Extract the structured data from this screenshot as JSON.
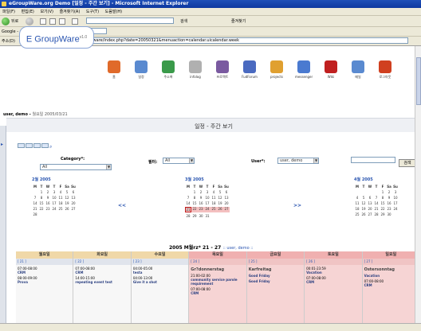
{
  "window": {
    "title": "eGroupWare.org Demo [일정 - 주간 보기] - Microsoft Internet Explorer"
  },
  "menu": [
    "파일(F)",
    "편집(E)",
    "보기(V)",
    "즐겨찾기(A)",
    "도구(T)",
    "도움말(H)"
  ],
  "toolbar": {
    "back": "뒤로",
    "search_label": "검색",
    "favorites_label": "즐겨찾기"
  },
  "linksbar": {
    "google_label": "Google -"
  },
  "address": {
    "label": "주소(D)",
    "url": "http://www.egroupware.org/egroupware/index.php?date=20050321&menuaction=calendar.uicalendar.week"
  },
  "logo": {
    "text": "E GroupWare",
    "version": "v1.0"
  },
  "apps": [
    {
      "label": "홈",
      "color": "#e06a2a"
    },
    {
      "label": "일정",
      "color": "#5a8ad0"
    },
    {
      "label": "주소록",
      "color": "#3a9a4a"
    },
    {
      "label": "infolog",
      "color": "#b0b0b0"
    },
    {
      "label": "프로젝트",
      "color": "#7a5aa0"
    },
    {
      "label": "FudForum",
      "color": "#4a6ac0"
    },
    {
      "label": "projects",
      "color": "#e0a030"
    },
    {
      "label": "messenger",
      "color": "#4a7ad0"
    },
    {
      "label": "Wiki",
      "color": "#c02020"
    },
    {
      "label": "메일",
      "color": "#5a8ad0"
    },
    {
      "label": "로그아웃",
      "color": "#d04020"
    }
  ],
  "user_line": {
    "user": "user, demo -",
    "date": "월요일 2005/03/21"
  },
  "page_title": "일정 - 주간 보기",
  "filters": {
    "category_label": "Category*:",
    "category_value": "All",
    "filter_label": "필터:",
    "filter_value": "All",
    "user_label": "User*:",
    "user_value": "user, demo",
    "go_label": "검색"
  },
  "calendars": [
    {
      "month": "2월 2005",
      "weekdays": [
        "M",
        "T",
        "W",
        "T",
        "F",
        "Sa",
        "Su"
      ],
      "rows": [
        [
          "",
          "1",
          "2",
          "3",
          "4",
          "5",
          "6"
        ],
        [
          "7",
          "8",
          "9",
          "10",
          "11",
          "12",
          "13"
        ],
        [
          "14",
          "15",
          "16",
          "17",
          "18",
          "19",
          "20"
        ],
        [
          "21",
          "22",
          "23",
          "24",
          "25",
          "26",
          "27"
        ],
        [
          "28",
          "",
          "",
          "",
          "",
          "",
          ""
        ]
      ]
    },
    {
      "month": "3월 2005",
      "weekdays": [
        "M",
        "T",
        "W",
        "T",
        "F",
        "Sa",
        "Su"
      ],
      "rows": [
        [
          "",
          "1",
          "2",
          "3",
          "4",
          "5",
          "6"
        ],
        [
          "7",
          "8",
          "9",
          "10",
          "11",
          "12",
          "13"
        ],
        [
          "14",
          "15",
          "16",
          "17",
          "18",
          "19",
          "20"
        ],
        [
          "21",
          "22",
          "23",
          "24",
          "25",
          "26",
          "27"
        ],
        [
          "28",
          "29",
          "30",
          "31",
          "",
          "",
          ""
        ]
      ]
    },
    {
      "month": "4월 2005",
      "weekdays": [
        "M",
        "T",
        "W",
        "T",
        "F",
        "Sa",
        "Su"
      ],
      "rows": [
        [
          "",
          "",
          "",
          "",
          "1",
          "2",
          "3"
        ],
        [
          "4",
          "5",
          "6",
          "7",
          "8",
          "9",
          "10"
        ],
        [
          "11",
          "12",
          "13",
          "14",
          "15",
          "16",
          "17"
        ],
        [
          "18",
          "19",
          "20",
          "21",
          "22",
          "23",
          "24"
        ],
        [
          "25",
          "26",
          "27",
          "28",
          "29",
          "30",
          ""
        ]
      ]
    }
  ],
  "nav": {
    "prev": "<<",
    "next": ">>"
  },
  "week_heading": {
    "title": "2005 M월rz* 21 - 27",
    "user": "user, demo"
  },
  "week": [
    {
      "name": "월요일",
      "date": "[ 21 ]",
      "events": [
        {
          "time": "07:00-08:00",
          "text": "CRM"
        },
        {
          "time": "08:00-09:00",
          "text": "Prova"
        }
      ]
    },
    {
      "name": "화요일",
      "date": "[ 22 ]",
      "events": [
        {
          "time": "07:00-08:00",
          "text": "CRM"
        },
        {
          "time": "14:00-15:00",
          "text": "repeating event test"
        }
      ]
    },
    {
      "name": "수요일",
      "date": "[ 23 ]",
      "events": [
        {
          "time": "04:00-05:00",
          "text": "testa"
        },
        {
          "time": "04:00-13:00",
          "text": "Give it a shot"
        }
      ]
    },
    {
      "name": "목요일",
      "date": "[ 24 ]",
      "title": "Gr?donnerstag",
      "events": [
        {
          "time": "21:00-02:00",
          "text": "community service parole requirement"
        },
        {
          "time": "07:00-08:00",
          "text": "CRM"
        }
      ]
    },
    {
      "name": "금요일",
      "date": "[ 25 ]",
      "title": "Karfreitag",
      "events": [
        {
          "time": "",
          "text": "Good Friday"
        },
        {
          "time": "",
          "text": "Good Friday"
        }
      ]
    },
    {
      "name": "토요일",
      "date": "[ 26 ]",
      "events": [
        {
          "time": "00:01-23:59",
          "text": "Vacation"
        },
        {
          "time": "07:00-08:00",
          "text": "CRM"
        }
      ]
    },
    {
      "name": "일요일",
      "date": "[ 27 ]",
      "title": "Ostersonntag",
      "events": [
        {
          "time": "",
          "text": "Vacation"
        },
        {
          "time": "07:00-08:00",
          "text": "CRM"
        }
      ]
    }
  ]
}
